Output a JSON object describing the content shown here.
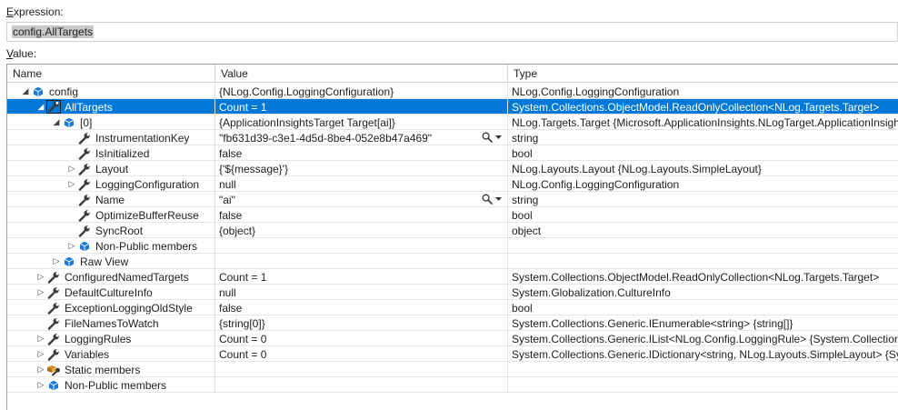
{
  "expression": {
    "label_prefix": "E",
    "label_rest": "xpression:",
    "value": "config.AllTargets"
  },
  "value_label": {
    "label_prefix": "V",
    "label_rest": "alue:"
  },
  "columns": {
    "name": "Name",
    "value": "Value",
    "type": "Type"
  },
  "colors": {
    "selection": "#0078d7",
    "cube": "#1e7ad8",
    "wrench": "#3a3a3a",
    "static": "#d08a2a"
  },
  "rows": [
    {
      "name": "config",
      "value": "{NLog.Config.LoggingConfiguration}",
      "type": "NLog.Config.LoggingConfiguration",
      "level": 0,
      "expander": "expanded",
      "icon": "cube-icon"
    },
    {
      "name": "AllTargets",
      "value": "Count = 1",
      "type": "System.Collections.ObjectModel.ReadOnlyCollection<NLog.Targets.Target>",
      "level": 1,
      "expander": "expanded",
      "icon": "property-wrench-icon",
      "selected": true
    },
    {
      "name": "[0]",
      "value": "{ApplicationInsightsTarget Target[ai]}",
      "type": "NLog.Targets.Target {Microsoft.ApplicationInsights.NLogTarget.ApplicationInsightsTarget}",
      "level": 2,
      "expander": "expanded",
      "icon": "cube-icon"
    },
    {
      "name": "InstrumentationKey",
      "value": "\"fb631d39-c3e1-4d5d-8be4-052e8b47a469\"",
      "type": "string",
      "level": 3,
      "expander": "none",
      "icon": "wrench-icon",
      "magnifier": true
    },
    {
      "name": "IsInitialized",
      "value": "false",
      "type": "bool",
      "level": 3,
      "expander": "none",
      "icon": "wrench-icon"
    },
    {
      "name": "Layout",
      "value": "{'${message}'}",
      "type": "NLog.Layouts.Layout {NLog.Layouts.SimpleLayout}",
      "level": 3,
      "expander": "collapsed",
      "icon": "wrench-icon"
    },
    {
      "name": "LoggingConfiguration",
      "value": "null",
      "type": "NLog.Config.LoggingConfiguration",
      "level": 3,
      "expander": "collapsed",
      "icon": "wrench-icon"
    },
    {
      "name": "Name",
      "value": "\"ai\"",
      "type": "string",
      "level": 3,
      "expander": "none",
      "icon": "wrench-icon",
      "magnifier": true
    },
    {
      "name": "OptimizeBufferReuse",
      "value": "false",
      "type": "bool",
      "level": 3,
      "expander": "none",
      "icon": "wrench-icon"
    },
    {
      "name": "SyncRoot",
      "value": "{object}",
      "type": "object",
      "level": 3,
      "expander": "none",
      "icon": "wrench-icon"
    },
    {
      "name": "Non-Public members",
      "value": "",
      "type": "",
      "level": 3,
      "expander": "collapsed",
      "icon": "cube-icon"
    },
    {
      "name": "Raw View",
      "value": "",
      "type": "",
      "level": 2,
      "expander": "collapsed",
      "icon": "cube-icon"
    },
    {
      "name": "ConfiguredNamedTargets",
      "value": "Count = 1",
      "type": "System.Collections.ObjectModel.ReadOnlyCollection<NLog.Targets.Target>",
      "level": 1,
      "expander": "collapsed",
      "icon": "wrench-icon"
    },
    {
      "name": "DefaultCultureInfo",
      "value": "null",
      "type": "System.Globalization.CultureInfo",
      "level": 1,
      "expander": "collapsed",
      "icon": "wrench-icon"
    },
    {
      "name": "ExceptionLoggingOldStyle",
      "value": "false",
      "type": "bool",
      "level": 1,
      "expander": "none",
      "icon": "wrench-icon"
    },
    {
      "name": "FileNamesToWatch",
      "value": "{string[0]}",
      "type": "System.Collections.Generic.IEnumerable<string> {string[]}",
      "level": 1,
      "expander": "none",
      "icon": "wrench-icon"
    },
    {
      "name": "LoggingRules",
      "value": "Count = 0",
      "type": "System.Collections.Generic.IList<NLog.Config.LoggingRule> {System.Collections.Generic.List<NLog.Config.LoggingRule>}",
      "level": 1,
      "expander": "collapsed",
      "icon": "wrench-icon"
    },
    {
      "name": "Variables",
      "value": "Count = 0",
      "type": "System.Collections.Generic.IDictionary<string, NLog.Layouts.SimpleLayout> {System.Collections.Generic.Dictionary<string, NLog.Layouts.SimpleLayout>}",
      "level": 1,
      "expander": "collapsed",
      "icon": "wrench-icon"
    },
    {
      "name": "Static members",
      "value": "",
      "type": "",
      "level": 1,
      "expander": "collapsed",
      "icon": "static-members-icon"
    },
    {
      "name": "Non-Public members",
      "value": "",
      "type": "",
      "level": 1,
      "expander": "collapsed",
      "icon": "cube-icon"
    }
  ]
}
